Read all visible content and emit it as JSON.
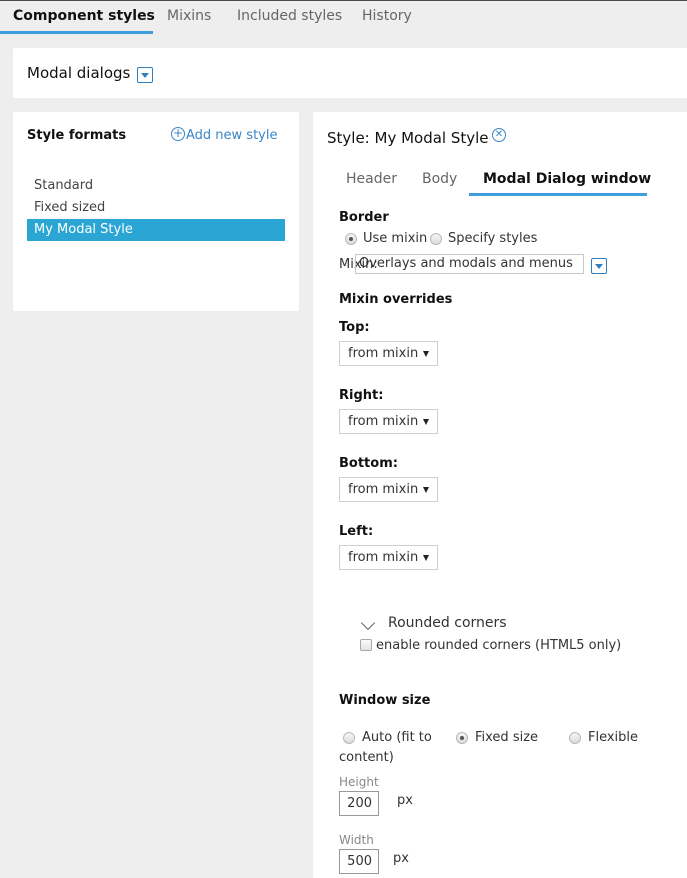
{
  "top_tabs": [
    {
      "label": "Component styles",
      "active": true
    },
    {
      "label": "Mixins",
      "active": false
    },
    {
      "label": "Included styles",
      "active": false
    },
    {
      "label": "History",
      "active": false
    }
  ],
  "header": {
    "title": "Modal dialogs",
    "dropdown_icon": "chevron-down-icon"
  },
  "style_formats": {
    "title": "Style formats",
    "add_label": "Add new style",
    "add_icon": "plus-circle-icon",
    "items": [
      {
        "label": "Standard",
        "selected": false
      },
      {
        "label": "Fixed sized",
        "selected": false
      },
      {
        "label": "My Modal Style",
        "selected": true
      }
    ]
  },
  "style_editor": {
    "title": "Style:  My Modal Style",
    "close_icon": "close-circle-icon",
    "sub_tabs": [
      {
        "label": "Header",
        "active": false
      },
      {
        "label": "Body",
        "active": false
      },
      {
        "label": "Modal Dialog window",
        "active": true
      }
    ],
    "border": {
      "label": "Border",
      "options": [
        {
          "label": "Use mixin",
          "checked": true
        },
        {
          "label": "Specify styles",
          "checked": false
        }
      ],
      "mixin_label": "Mixin:",
      "mixin_value": "Overlays and modals and menus"
    },
    "mixin_overrides": {
      "label": "Mixin overrides",
      "fields": [
        {
          "label": "Top:",
          "value": "from mixin"
        },
        {
          "label": "Right:",
          "value": "from mixin"
        },
        {
          "label": "Bottom:",
          "value": "from mixin"
        },
        {
          "label": "Left:",
          "value": "from mixin"
        }
      ]
    },
    "rounded_corners": {
      "title": "Rounded corners",
      "checkbox_label": "enable rounded corners (HTML5 only)",
      "checked": false
    },
    "window_size": {
      "label": "Window size",
      "options": [
        {
          "label": "Auto (fit to",
          "label_line2": "content)",
          "checked": false
        },
        {
          "label": "Fixed size",
          "checked": true
        },
        {
          "label": "Flexible",
          "checked": false
        }
      ],
      "height_label": "Height",
      "height_value": "200",
      "width_label": "Width",
      "width_value": "500",
      "unit": "px"
    }
  },
  "colors": {
    "accent": "#3e9ddc",
    "selected_row": "#2ba5d4",
    "link": "#3a86c8",
    "background": "#eeeeee"
  }
}
